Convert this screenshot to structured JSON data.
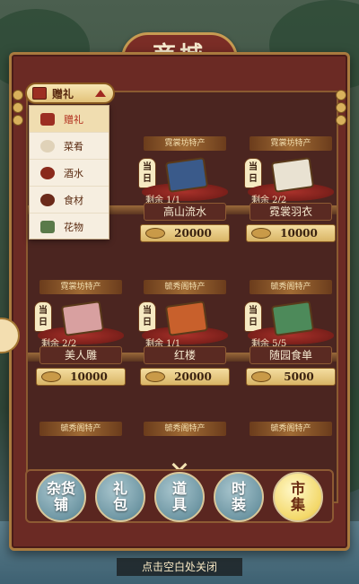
{
  "title": "商城",
  "dropdown": {
    "selected": "赠礼",
    "options": [
      {
        "label": "赠礼",
        "icon": "gift-box-icon",
        "active": true
      },
      {
        "label": "菜肴",
        "icon": "dish-icon",
        "active": false
      },
      {
        "label": "酒水",
        "icon": "wine-jar-icon",
        "active": false
      },
      {
        "label": "食材",
        "icon": "ingredient-icon",
        "active": false
      },
      {
        "label": "花物",
        "icon": "flower-icon",
        "active": false
      }
    ]
  },
  "daily_badge": "当日",
  "items": [
    {
      "tag": "霓裳坊特产",
      "remain": "剩余 1/1",
      "name": "高山流水",
      "price": "20000",
      "icon": "blue-robe-icon"
    },
    {
      "tag": "霓裳坊特产",
      "remain": "剩余 2/2",
      "name": "霓裳羽衣",
      "price": "10000",
      "icon": "folded-garment-icon"
    },
    {
      "tag": "霓裳坊特产",
      "remain": "剩余 2/2",
      "name": "美人雕",
      "price": "10000",
      "icon": "lady-statue-icon"
    },
    {
      "tag": "毓秀阁特产",
      "remain": "剩余 1/1",
      "name": "红楼",
      "price": "20000",
      "icon": "book-scroll-icon"
    },
    {
      "tag": "毓秀阁特产",
      "remain": "剩余 5/5",
      "name": "随园食单",
      "price": "5000",
      "icon": "green-book-icon"
    }
  ],
  "partial_tags": [
    "毓秀阁特产",
    "毓秀阁特产",
    "毓秀阁特产"
  ],
  "nav": [
    {
      "label": "杂货\n铺",
      "active": false
    },
    {
      "label": "礼\n包",
      "active": false
    },
    {
      "label": "道\n具",
      "active": false
    },
    {
      "label": "时\n装",
      "active": false
    },
    {
      "label": "市\n集",
      "active": true
    }
  ],
  "close_hint": "点击空白处关闭",
  "colors": {
    "cabinet": "#6b2a24",
    "gold": "#c79b52",
    "active_nav": "#f3d86a"
  }
}
